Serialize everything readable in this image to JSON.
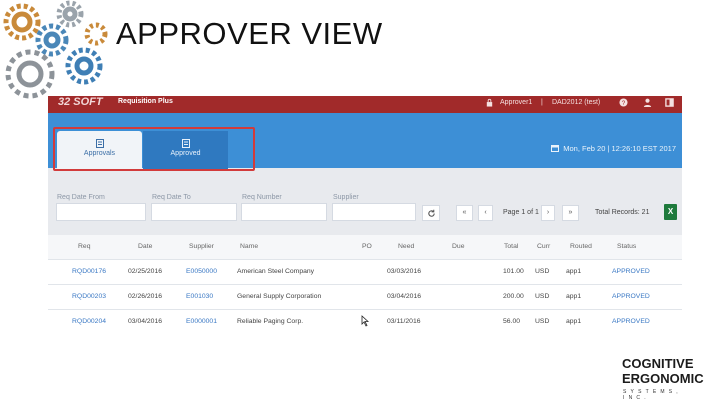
{
  "slide": {
    "title": "APPROVER VIEW"
  },
  "app": {
    "brand": "32 SOFT",
    "subtitle": "Requisition Plus",
    "user": "Approver1",
    "separator": "|",
    "company": "DAD2012 (test)",
    "tabs": [
      {
        "label": "Approvals"
      },
      {
        "label": "Approved"
      }
    ],
    "datetime": "Mon, Feb 20 | 12:26:10 EST 2017",
    "filters": {
      "req_date_from": "Req Date From",
      "req_date_to": "Req Date To",
      "req_number": "Req Number",
      "supplier": "Supplier"
    },
    "pager": {
      "first": "«",
      "prev": "‹",
      "next": "›",
      "last": "»",
      "page_label": "Page",
      "page": "1",
      "of": "of 1",
      "total": "Total Records: 21"
    },
    "table": {
      "headers": [
        "Req",
        "Date",
        "Supplier",
        "Name",
        "PO",
        "Need",
        "Due",
        "Total",
        "Curr",
        "Routed",
        "Status"
      ],
      "rows": [
        {
          "req": "RQD00176",
          "date": "02/25/2016",
          "supplier": "E0050000",
          "name": "American Steel Company",
          "po": "",
          "need": "03/03/2016",
          "due": "",
          "total": "101.00",
          "curr": "USD",
          "routed": "app1",
          "status": "APPROVED"
        },
        {
          "req": "RQD00203",
          "date": "02/26/2016",
          "supplier": "E001030",
          "name": "General Supply Corporation",
          "po": "",
          "need": "03/04/2016",
          "due": "",
          "total": "200.00",
          "curr": "USD",
          "routed": "app1",
          "status": "APPROVED"
        },
        {
          "req": "RQD00204",
          "date": "03/04/2016",
          "supplier": "E0000001",
          "name": "Reliable Paging Corp.",
          "po": "",
          "need": "03/11/2016",
          "due": "",
          "total": "56.00",
          "curr": "USD",
          "routed": "app1",
          "status": "APPROVED"
        }
      ]
    }
  },
  "logo": {
    "line1": "COGNITIVE",
    "line2": "ERGONOMIC",
    "line3": "SYSTEMS, INC."
  },
  "colors": {
    "topbar": "#a12a2a",
    "blueband": "#3d8fd6",
    "highlight": "#d23b3b",
    "link": "#3a78c4"
  },
  "icons": [
    "gears-icon",
    "lock-icon",
    "help-icon",
    "user-icon",
    "exit-icon",
    "approvals-icon",
    "approved-icon",
    "calendar-icon",
    "refresh-icon",
    "excel-icon",
    "cursor-icon"
  ]
}
